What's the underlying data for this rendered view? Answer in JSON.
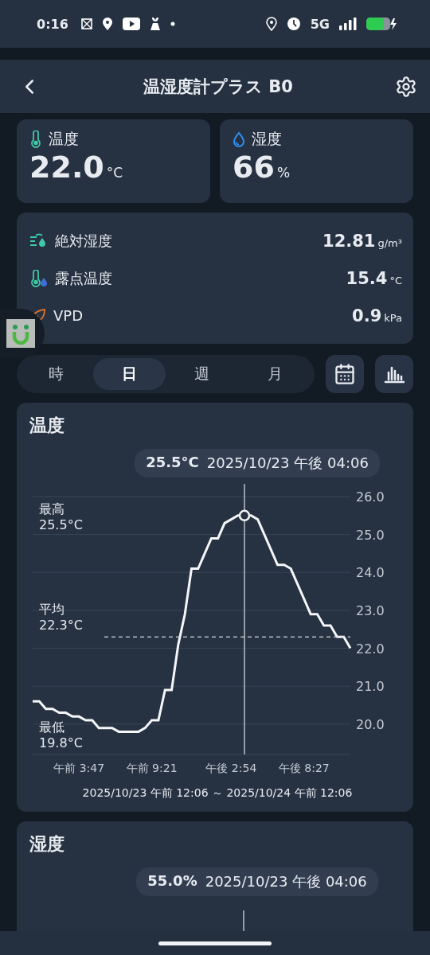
{
  "status_bar": {
    "time": "0:16",
    "network": "5G"
  },
  "header": {
    "title": "温湿度計プラス B0"
  },
  "readings": [
    {
      "kind": "temperature",
      "label": "温度",
      "value": "22.0",
      "unit": "°C"
    },
    {
      "kind": "humidity",
      "label": "湿度",
      "value": "66",
      "unit": "%"
    }
  ],
  "details": [
    {
      "kind": "absolute_humidity",
      "label": "絶対湿度",
      "value": "12.81",
      "unit": "g/m³"
    },
    {
      "kind": "dew_point",
      "label": "露点温度",
      "value": "15.4",
      "unit": "°C"
    },
    {
      "kind": "vpd",
      "label": "VPD",
      "value": "0.9",
      "unit": "kPa"
    }
  ],
  "period_tabs": [
    {
      "label": "時",
      "selected": false
    },
    {
      "label": "日",
      "selected": true
    },
    {
      "label": "週",
      "selected": false
    },
    {
      "label": "月",
      "selected": false
    }
  ],
  "charts": [
    {
      "title": "温度",
      "tooltip": {
        "value": "25.5°C",
        "time": "2025/10/23 午後 04:06"
      },
      "stats": [
        {
          "kind": "max",
          "label": "最高",
          "value": "25.5°C"
        },
        {
          "kind": "avg",
          "label": "平均",
          "value": "22.3°C"
        },
        {
          "kind": "min",
          "label": "最低",
          "value": "19.8°C"
        }
      ],
      "range": "2025/10/23 午前 12:06 ～ 2025/10/24 午前 12:06",
      "chart_data": {
        "type": "line",
        "ylim": [
          19.2,
          26.0
        ],
        "grid": true,
        "categories": [
          null,
          null,
          null,
          null,
          null,
          null,
          null,
          "午前 3:47",
          null,
          null,
          null,
          null,
          null,
          null,
          null,
          null,
          null,
          null,
          "午前 9:21",
          null,
          null,
          null,
          null,
          null,
          null,
          null,
          null,
          null,
          null,
          null,
          "午後 2:54",
          null,
          null,
          null,
          null,
          null,
          null,
          null,
          null,
          null,
          null,
          "午後 8:27",
          null,
          null,
          null,
          null,
          null,
          null,
          null
        ],
        "series": [
          {
            "color": "#f4f6f8",
            "values": [
              20.6,
              20.6,
              20.4,
              20.4,
              20.3,
              20.3,
              20.2,
              20.2,
              20.1,
              20.1,
              19.9,
              19.9,
              19.9,
              19.8,
              19.8,
              19.8,
              19.8,
              19.9,
              20.1,
              20.1,
              20.9,
              20.9,
              22.1,
              22.9,
              24.1,
              24.1,
              24.5,
              24.9,
              24.9,
              25.3,
              25.4,
              25.5,
              25.5,
              25.5,
              25.4,
              25.0,
              24.6,
              24.2,
              24.2,
              24.1,
              23.7,
              23.3,
              22.9,
              22.9,
              22.6,
              22.6,
              22.3,
              22.3,
              22.0
            ]
          }
        ],
        "yticks": [
          {
            "value": 20,
            "label": "20.0"
          },
          {
            "value": 21,
            "label": "21.0"
          },
          {
            "value": 22,
            "label": "22.0"
          },
          {
            "value": 23,
            "label": "23.0"
          },
          {
            "value": 24,
            "label": "24.0"
          },
          {
            "value": 25,
            "label": "25.0"
          },
          {
            "value": 26,
            "label": "26.0"
          }
        ],
        "ref_lines": [
          {
            "axis": "y",
            "value": 22.3
          }
        ]
      }
    },
    {
      "title": "湿度",
      "tooltip": {
        "value": "55.0%",
        "time": "2025/10/23 午後 04:06"
      }
    }
  ]
}
